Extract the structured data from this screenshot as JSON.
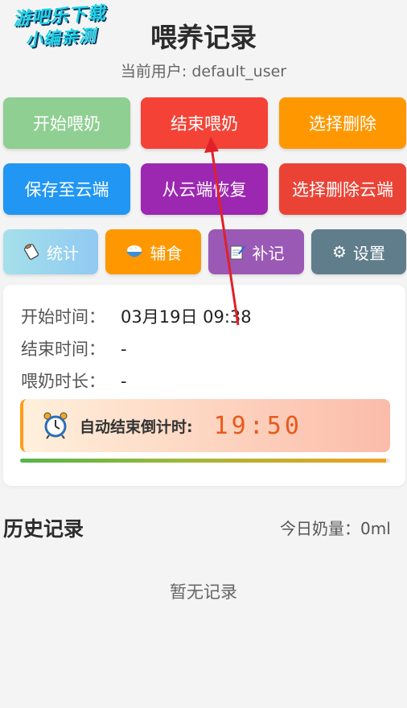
{
  "watermark": {
    "line1": "游吧乐下载",
    "line2": "小编亲测"
  },
  "header": {
    "title": "喂养记录",
    "user_label": "当前用户: default_user"
  },
  "buttons": {
    "start": {
      "label": "开始喂奶",
      "color": "#8fcf92"
    },
    "end": {
      "label": "结束喂奶",
      "color": "#f44336"
    },
    "select_delete": {
      "label": "选择删除",
      "color": "#ff9800"
    },
    "save_cloud": {
      "label": "保存至云端",
      "color": "#2196f3"
    },
    "restore_cloud": {
      "label": "从云端恢复",
      "color": "#9c27b0"
    },
    "delete_cloud": {
      "label": "选择删除云端",
      "color": "#ea4335"
    }
  },
  "tools": {
    "stats": {
      "label": "统计",
      "icon": "clipboard-icon"
    },
    "solid_food": {
      "label": "辅食",
      "icon": "rice-bowl-icon"
    },
    "supplement": {
      "label": "补记",
      "icon": "memo-icon"
    },
    "settings": {
      "label": "设置",
      "icon": "gear-icon"
    }
  },
  "status": {
    "start_label": "开始时间：",
    "start_value": "03月19日 09:38",
    "end_label": "结束时间：",
    "end_value": "-",
    "duration_label": "喂奶时长：",
    "duration_value": "-",
    "countdown_label": "自动结束倒计时:",
    "countdown_value": "19:50",
    "countdown_progress": 0.99
  },
  "history": {
    "title": "历史记录",
    "today_amount": "今日奶量：0ml",
    "empty_text": "暂无记录"
  }
}
